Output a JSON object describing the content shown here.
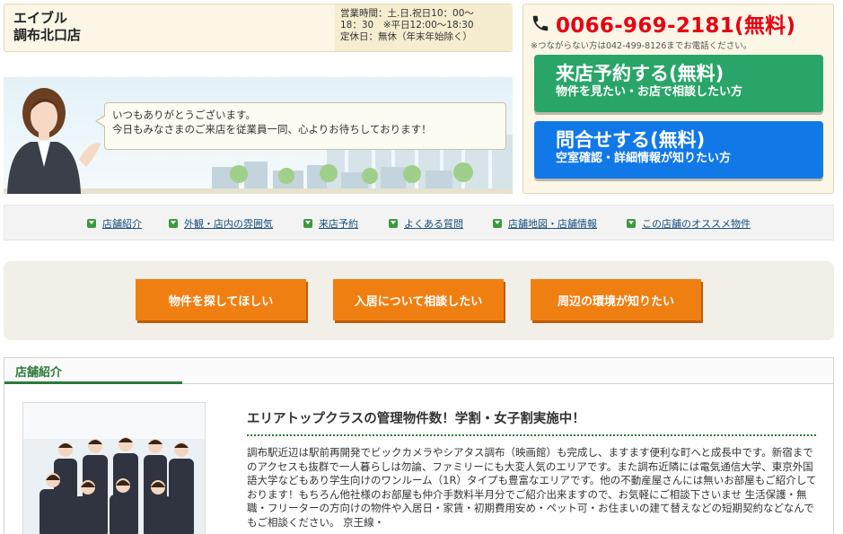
{
  "shop": {
    "brand": "エイブル",
    "branch": "調布北口店",
    "hours_line1": "営業時間：土.日.祝日10：00～",
    "hours_line2": "18：30　※平日12:00～18:30",
    "closed": "定休日：無休（年末年始除く）"
  },
  "contact": {
    "phone": "0066-969-2181(無料)",
    "phone_note": "※つながらない方は042-499-8126までお電話ください。",
    "visit_main": "来店予約する(無料)",
    "visit_sub": "物件を見たい・お店で相談したい方",
    "inquiry_main": "問合せする(無料)",
    "inquiry_sub": "空室確認・詳細情報が知りたい方"
  },
  "greeting": {
    "line1": "いつもありがとうございます。",
    "line2": "今日もみなさまのご来店を従業員一同、心よりお待ちしております！"
  },
  "nav": [
    "店舗紹介",
    "外観・店内の雰囲気",
    "来店予約",
    "よくある質問",
    "店舗地図・店舗情報",
    "この店舗のオススメ物件"
  ],
  "buttons": [
    "物件を探してほしい",
    "入居について相談したい",
    "周辺の環境が知りたい"
  ],
  "intro": {
    "section_title": "店舗紹介",
    "heading": "エリアトップクラスの管理物件数！学割・女子割実施中！",
    "body": "調布駅近辺は駅前再開発でビックカメラやシアタス調布（映画館）も完成し、ますます便利な町へと成長中です。新宿までのアクセスも抜群で一人暮らしは勿論、ファミリーにも大変人気のエリアです。また調布近隣には電気通信大学、東京外国語大学などもあり学生向けのワンルーム（1R）タイプも豊富なエリアです。他の不動産屋さんには無いお部屋もご紹介しております！もちろん他社様のお部屋も仲介手数料半月分でご紹介出来ますので、お気軽にご相談下さいませ 生活保護・無職・フリーターの方向けの物件や入居日・家賃・初期費用安め・ペット可・お住まいの建て替えなどの短期契約などなんでもご相談ください。 京王線・"
  },
  "colors": {
    "phone_red": "#e60012",
    "visit_green": "#2aa56a",
    "inquiry_blue": "#1178e8",
    "orange_button": "#f07f12",
    "section_green": "#2b7a3a"
  }
}
